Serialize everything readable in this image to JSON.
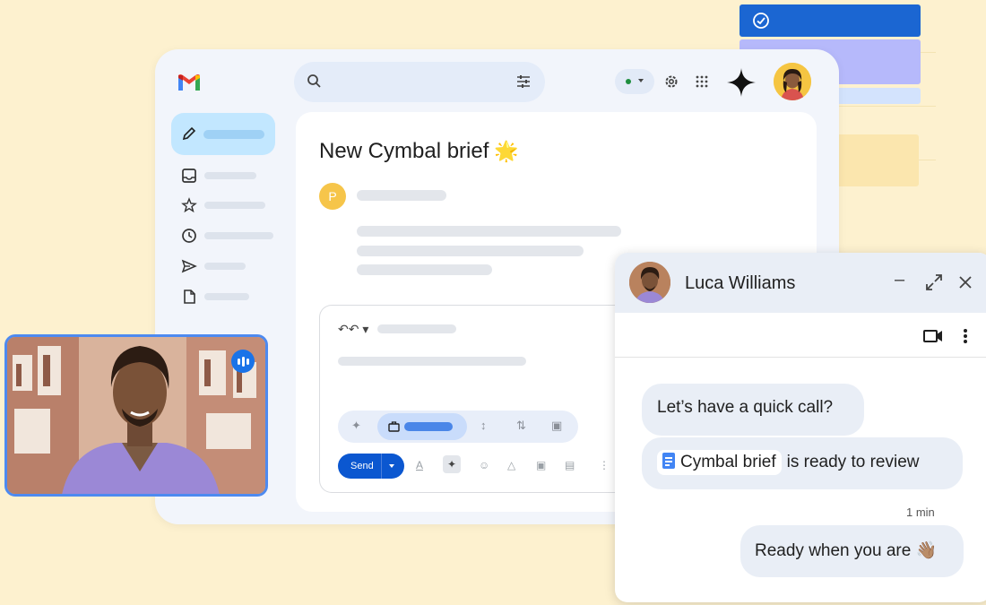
{
  "email": {
    "subject": "New Cymbal brief",
    "subject_emoji": "🌟",
    "sender_initial": "P"
  },
  "composer": {
    "send_label": "Send"
  },
  "chat": {
    "contact_name": "Luca Williams",
    "messages": [
      {
        "text": "Let’s have a quick call?"
      },
      {
        "doc_chip": "Cymbal brief",
        "text": "is ready to review"
      }
    ],
    "timestamp": "1 min",
    "my_message": "Ready when you are",
    "my_emoji": "👋🏽"
  },
  "colors": {
    "background": "#fdf1cf",
    "accent": "#0b57d0",
    "compose": "#c2e7ff",
    "presence": "#1e8e3e"
  },
  "icons": {
    "window": [
      "minimize-icon",
      "expand-icon",
      "close-icon"
    ],
    "chat_tools": [
      "video-call-icon",
      "more-vert-icon"
    ]
  }
}
